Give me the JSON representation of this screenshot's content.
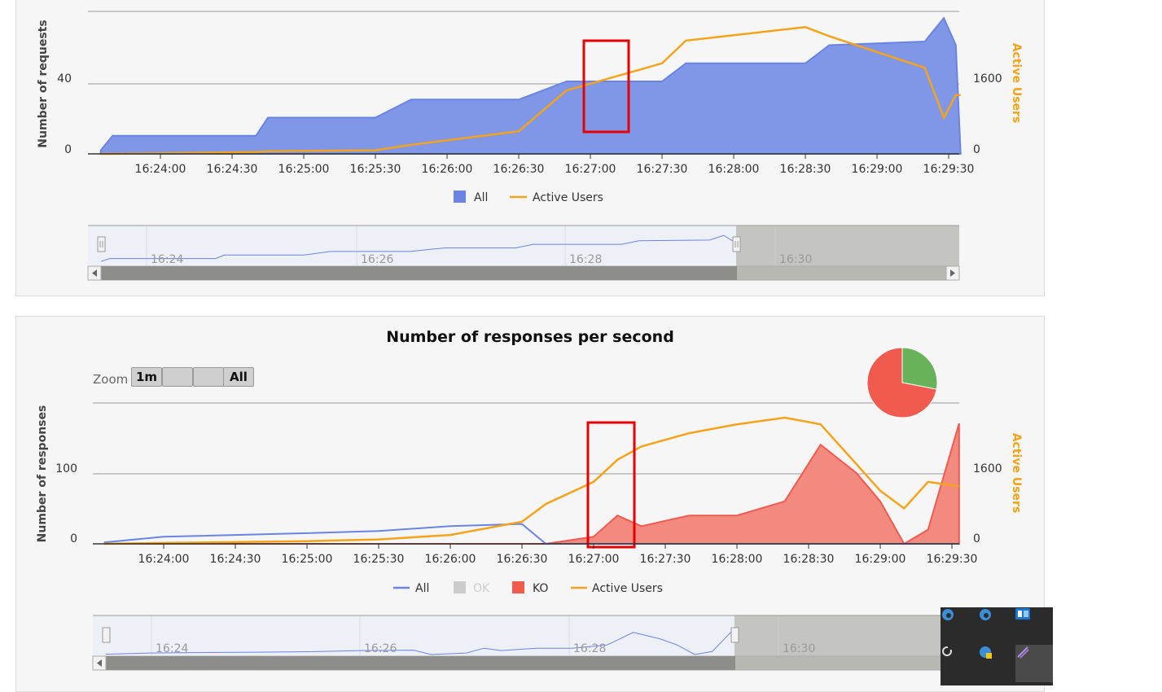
{
  "colors": {
    "all": "#6a84e3",
    "all_fill": "#8097e8",
    "active_users": "#f5a31a",
    "ko": "#f05a4f",
    "ko_fill": "#f28a80",
    "ok": "#cccccc",
    "ok_pie": "#68b35a",
    "highlight": "#e60000"
  },
  "chart_requests": {
    "ylabel": "Number of requests",
    "y2label": "Active Users",
    "yticks": [
      "0",
      "40"
    ],
    "y2ticks": [
      "0",
      "1600"
    ],
    "xticks": [
      "16:24:00",
      "16:24:30",
      "16:25:00",
      "16:25:30",
      "16:26:00",
      "16:26:30",
      "16:27:00",
      "16:27:30",
      "16:28:00",
      "16:28:30",
      "16:29:00",
      "16:29:30"
    ],
    "legend": [
      "All",
      "Active Users"
    ],
    "navigator_labels": [
      "16:24",
      "16:26",
      "16:28",
      "16:30"
    ]
  },
  "chart_responses": {
    "title": "Number of responses per second",
    "zoom_label": "Zoom",
    "zoom_buttons": [
      "1m",
      "",
      "",
      "All"
    ],
    "ylabel": "Number of responses",
    "y2label": "Active Users",
    "yticks": [
      "0",
      "100"
    ],
    "y2ticks": [
      "0",
      "1600"
    ],
    "xticks": [
      "16:24:00",
      "16:24:30",
      "16:25:00",
      "16:25:30",
      "16:26:00",
      "16:26:30",
      "16:27:00",
      "16:27:30",
      "16:28:00",
      "16:28:30",
      "16:29:00",
      "16:29:30"
    ],
    "legend": [
      "All",
      "OK",
      "KO",
      "Active Users"
    ],
    "navigator_labels": [
      "16:24",
      "16:26",
      "16:28",
      "16:30"
    ]
  },
  "chart_data": [
    {
      "type": "area",
      "ylabel": "Number of requests",
      "y2label": "Active Users",
      "ylim": [
        0,
        80
      ],
      "y2lim": [
        0,
        3200
      ],
      "x": [
        "16:23:35",
        "16:23:40",
        "16:24:10",
        "16:24:40",
        "16:24:45",
        "16:25:30",
        "16:25:45",
        "16:26:30",
        "16:26:50",
        "16:27:30",
        "16:27:40",
        "16:28:30",
        "16:28:40",
        "16:29:20",
        "16:29:28",
        "16:29:33",
        "16:29:35"
      ],
      "series": [
        {
          "name": "All",
          "values": [
            2,
            10,
            10,
            10,
            20,
            20,
            30,
            30,
            40,
            40,
            50,
            50,
            60,
            62,
            75,
            60,
            0
          ]
        },
        {
          "name": "Active Users",
          "values": [
            0,
            0,
            20,
            40,
            60,
            80,
            200,
            500,
            1400,
            2000,
            2500,
            2800,
            2600,
            1900,
            800,
            1300,
            1300
          ]
        }
      ]
    },
    {
      "type": "area",
      "title": "Number of responses per second",
      "ylabel": "Number of responses",
      "y2label": "Active Users",
      "ylim": [
        0,
        200
      ],
      "y2lim": [
        0,
        3200
      ],
      "x": [
        "16:23:35",
        "16:24:00",
        "16:25:00",
        "16:25:30",
        "16:26:00",
        "16:26:30",
        "16:26:40",
        "16:27:00",
        "16:27:10",
        "16:27:20",
        "16:27:40",
        "16:28:00",
        "16:28:20",
        "16:28:35",
        "16:28:50",
        "16:29:00",
        "16:29:10",
        "16:29:20",
        "16:29:33"
      ],
      "series": [
        {
          "name": "All",
          "values": [
            2,
            10,
            15,
            18,
            25,
            28,
            0,
            0,
            0,
            0,
            0,
            0,
            0,
            0,
            0,
            0,
            0,
            0,
            0
          ]
        },
        {
          "name": "KO",
          "values": [
            0,
            0,
            0,
            0,
            0,
            0,
            0,
            10,
            40,
            25,
            40,
            40,
            60,
            140,
            100,
            60,
            0,
            20,
            170
          ]
        },
        {
          "name": "Active Users",
          "values": [
            0,
            20,
            60,
            100,
            200,
            500,
            900,
            1400,
            1900,
            2200,
            2500,
            2700,
            2850,
            2700,
            1800,
            1200,
            800,
            1400,
            1300
          ]
        }
      ]
    },
    {
      "type": "pie",
      "categories": [
        "OK",
        "KO"
      ],
      "values": [
        28,
        72
      ]
    }
  ]
}
